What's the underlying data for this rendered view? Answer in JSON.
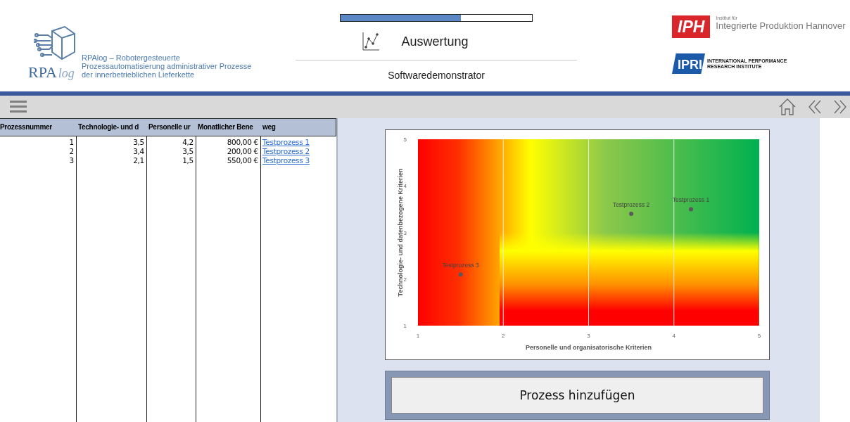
{
  "header": {
    "logo": {
      "mark": "RPA",
      "mark_suffix": "log"
    },
    "project_lines": [
      "RPAlog – Robotergesteuerte",
      "Prozessautomatisierung administrativer Prozesse",
      "der innerbetrieblichen Lieferkette"
    ],
    "progress": {
      "level": 0.63
    },
    "page_title": "Auswertung",
    "subtitle": "Softwaredemonstrator",
    "partners": [
      {
        "kind": "iph",
        "mark": "IPH",
        "small": "Institut für",
        "name": "Integrierte Produktion Hannover"
      },
      {
        "kind": "ipri",
        "mark": "IPRI",
        "name_lines": [
          "INTERNATIONAL PERFORMANCE",
          "RESEARCH INSTITUTE"
        ]
      }
    ]
  },
  "table": {
    "columns": [
      "Prozessnummer",
      "Technologie- und d",
      "Personelle ur",
      "Monatlicher Bene",
      "weg"
    ],
    "rows": [
      {
        "number": "1",
        "tech": "3,5",
        "personal": "4,2",
        "benefit": "800,00 €",
        "link": "Testprozess 1"
      },
      {
        "number": "2",
        "tech": "3,4",
        "personal": "3,5",
        "benefit": "200,00 €",
        "link": "Testprozess 2"
      },
      {
        "number": "3",
        "tech": "2,1",
        "personal": "1,5",
        "benefit": "550,00 €",
        "link": "Testprozess 3"
      }
    ]
  },
  "chart": {
    "chart_data": {
      "type": "scatter",
      "xlabel": "Personelle und organisatorische Kriterien",
      "ylabel": "Technologie- und datenbezogene Kriterien",
      "xlim": [
        1,
        5
      ],
      "ylim": [
        1,
        5
      ],
      "xticks": [
        {
          "value": 1,
          "label": "1"
        },
        {
          "value": 2,
          "label": "2"
        },
        {
          "value": 3,
          "label": "3"
        },
        {
          "value": 4,
          "label": "4"
        },
        {
          "value": 5,
          "label": "5"
        }
      ],
      "yticks": [
        {
          "value": 1,
          "label": "1"
        },
        {
          "value": 2,
          "label": "2"
        },
        {
          "value": 3,
          "label": "3"
        },
        {
          "value": 4,
          "label": "4"
        },
        {
          "value": 5,
          "label": "5"
        }
      ],
      "grid": true,
      "x": [
        4.2,
        3.5,
        1.5
      ],
      "series": [
        {
          "name": "Testprozess 1",
          "color": "#595959",
          "values": [
            3.5,
            null,
            null
          ]
        },
        {
          "name": "Testprozess 2",
          "color": "#595959",
          "values": [
            null,
            3.4,
            null
          ]
        },
        {
          "name": "Testprozess 3",
          "color": "#595959",
          "values": [
            null,
            null,
            2.1
          ]
        }
      ]
    }
  },
  "add_button": "Prozess hinzufügen"
}
